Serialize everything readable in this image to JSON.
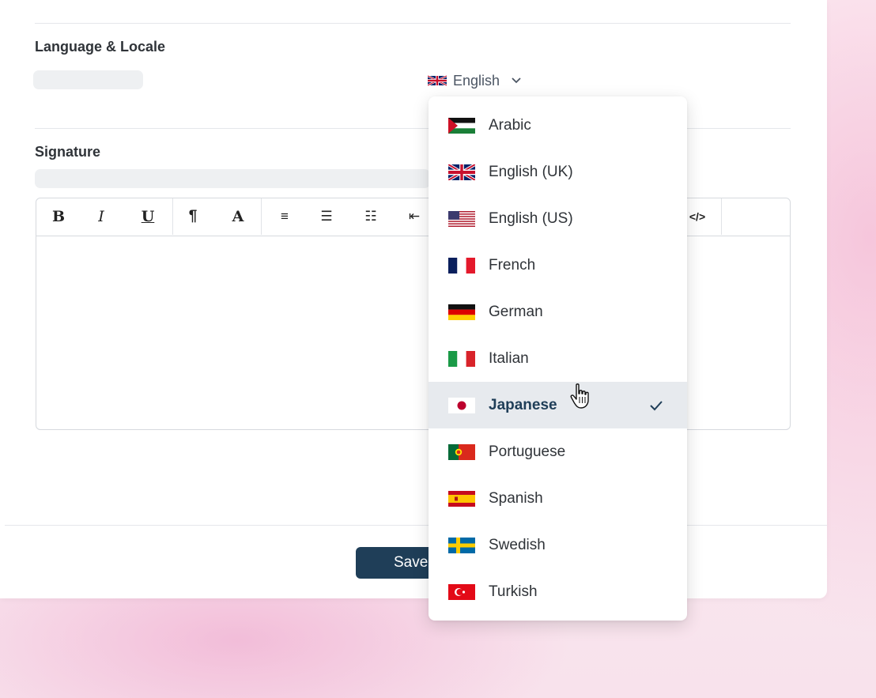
{
  "language_section": {
    "title": "Language & Locale",
    "selected_language": "English",
    "selected_flag": "uk-flag-icon"
  },
  "signature_section": {
    "title": "Signature",
    "toolbar": [
      {
        "label": "B",
        "name": "bold-button"
      },
      {
        "label": "I",
        "name": "italic-button"
      },
      {
        "label": "U",
        "name": "underline-button"
      },
      {
        "label": "¶",
        "name": "paragraph-button"
      },
      {
        "label": "A",
        "name": "text-color-button"
      },
      {
        "label": "≡",
        "name": "align-left-button"
      },
      {
        "label": "☰",
        "name": "bullet-list-button"
      },
      {
        "label": "☷",
        "name": "numbered-list-button"
      },
      {
        "label": "⇤",
        "name": "outdent-button"
      },
      {
        "label": "</>",
        "name": "code-view-button"
      }
    ]
  },
  "footer": {
    "save_label": "Save"
  },
  "language_dropdown": {
    "options": [
      {
        "label": "Arabic",
        "flag": "arabic-flag-icon",
        "selected": false
      },
      {
        "label": "English (UK)",
        "flag": "uk-flag-icon",
        "selected": false
      },
      {
        "label": "English (US)",
        "flag": "us-flag-icon",
        "selected": false
      },
      {
        "label": "French",
        "flag": "france-flag-icon",
        "selected": false
      },
      {
        "label": "German",
        "flag": "germany-flag-icon",
        "selected": false
      },
      {
        "label": "Italian",
        "flag": "italy-flag-icon",
        "selected": false
      },
      {
        "label": "Japanese",
        "flag": "japan-flag-icon",
        "selected": true
      },
      {
        "label": "Portuguese",
        "flag": "portugal-flag-icon",
        "selected": false
      },
      {
        "label": "Spanish",
        "flag": "spain-flag-icon",
        "selected": false
      },
      {
        "label": "Swedish",
        "flag": "sweden-flag-icon",
        "selected": false
      },
      {
        "label": "Turkish",
        "flag": "turkey-flag-icon",
        "selected": false
      }
    ],
    "check_icon": "check-icon"
  },
  "colors": {
    "primary": "#1f3e58",
    "selected_bg": "#e7eaee",
    "border": "#d6d9de",
    "text": "#2f3338"
  }
}
